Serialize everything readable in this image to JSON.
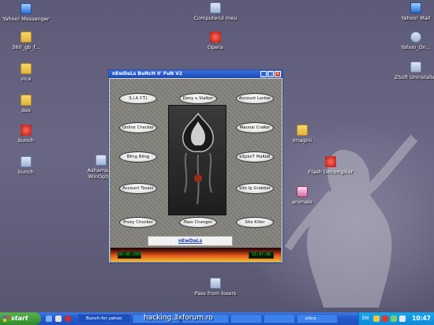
{
  "desktop": {
    "icons_left": [
      {
        "label": "Yahoo! Messenger",
        "icon": "yahoo-messenger-icon"
      },
      {
        "label": "360_gb_f...",
        "icon": "folder-icon"
      },
      {
        "label": "vice",
        "icon": "folder-icon"
      },
      {
        "label": "dex",
        "icon": "folder-icon"
      },
      {
        "label": "bunch",
        "icon": "file-icon"
      },
      {
        "label": "bunch",
        "icon": "audio-file-icon"
      }
    ],
    "icons_center": [
      {
        "label": "Computerul meu",
        "icon": "computer-icon"
      },
      {
        "label": "Opera",
        "icon": "opera-icon"
      },
      {
        "label": "Ashampoo WinOptim",
        "icon": "app-icon"
      },
      {
        "label": "Pass from losers",
        "icon": "text-file-icon"
      }
    ],
    "icons_right": [
      {
        "label": "Yahoo! Mail",
        "icon": "yahoo-mail-icon"
      },
      {
        "label": "Yahoo_On...",
        "icon": "cd-icon"
      },
      {
        "label": "ZSoft Uninstaller",
        "icon": "app-icon"
      },
      {
        "label": "Imagini",
        "icon": "folder-icon"
      },
      {
        "label": "Flash Decompiler",
        "icon": "flash-icon"
      },
      {
        "label": "animale",
        "icon": "image-icon"
      }
    ]
  },
  "window": {
    "title": "nEwDaLs BuNcH 0' FuN V2",
    "buttons_left": [
      "S.I.A.Y.T.I",
      "Online Checker",
      "Bling Bling",
      "Account Tosser",
      "Proxy Checker"
    ],
    "buttons_center": [
      "Deny a Stalker",
      "Pass Changer"
    ],
    "buttons_right": [
      "Account Locker",
      "Maunal CraKer",
      "eXploiT MaKeR",
      "Site Ip Grabber",
      "Site Killer"
    ],
    "sign": "nEwDaLs",
    "lcd_left": "00:00:2007",
    "lcd_right": "10:47:06"
  },
  "taskbar": {
    "start_label": "start",
    "tasks": [
      "Bunch-for yahoo",
      "",
      "",
      "",
      "",
      "ptica"
    ],
    "tray_lang": "EN",
    "clock": "10:47"
  },
  "watermark": "hacking.3xforum.ro"
}
